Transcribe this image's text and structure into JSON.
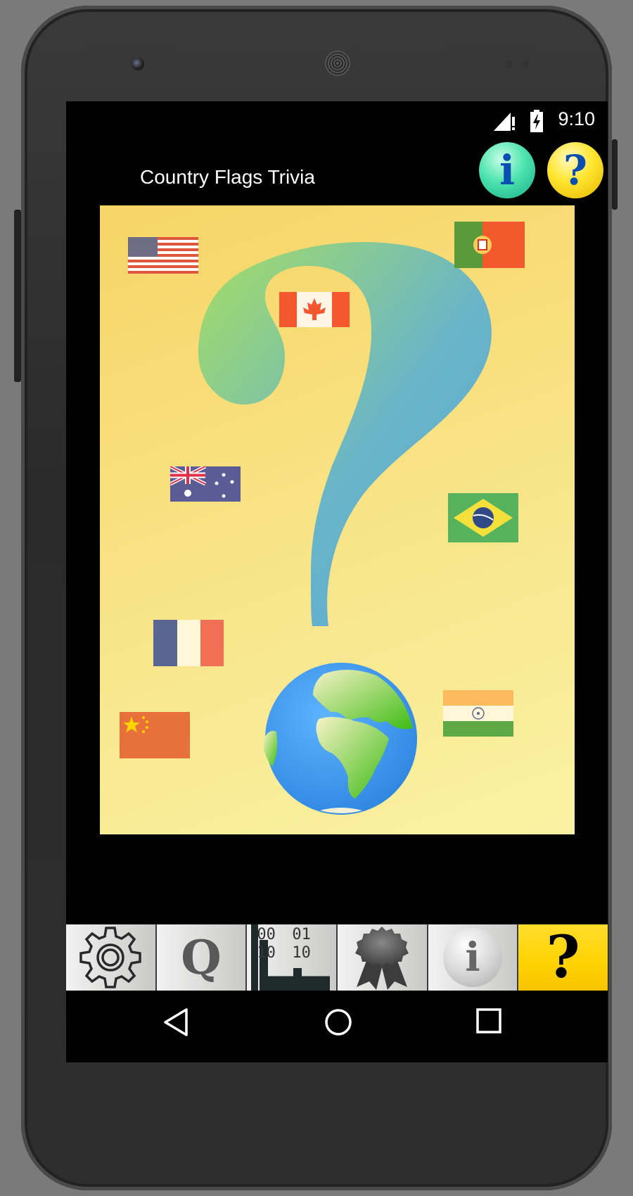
{
  "status_bar": {
    "time": "9:10",
    "signal_icon": "signal-no-data-icon",
    "battery_icon": "battery-charging-icon"
  },
  "app_bar": {
    "title": "Country Flags Trivia",
    "info_button": "i",
    "help_button": "?"
  },
  "splash": {
    "flags": [
      "USA",
      "Portugal",
      "Canada",
      "Australia",
      "Brazil",
      "France",
      "China",
      "India"
    ],
    "centerpiece": "question-mark",
    "globe_icon": "globe-icon"
  },
  "bottom_tabs": [
    {
      "icon": "gear-icon",
      "label": ""
    },
    {
      "icon": "quiz-icon",
      "label": "Q"
    },
    {
      "icon": "binary-stats-icon",
      "lines": [
        "00",
        "01",
        "10",
        "10"
      ]
    },
    {
      "icon": "award-ribbon-icon",
      "label": ""
    },
    {
      "icon": "info-icon",
      "label": "i"
    },
    {
      "icon": "help-icon",
      "label": "?"
    }
  ],
  "nav": {
    "back": "back-icon",
    "home": "home-icon",
    "recents": "recents-icon"
  },
  "colors": {
    "active_tab": "#ffd200",
    "info_button": "#2fd2a0",
    "help_button": "#ffe000",
    "splash_bg": "#f8e07a"
  }
}
